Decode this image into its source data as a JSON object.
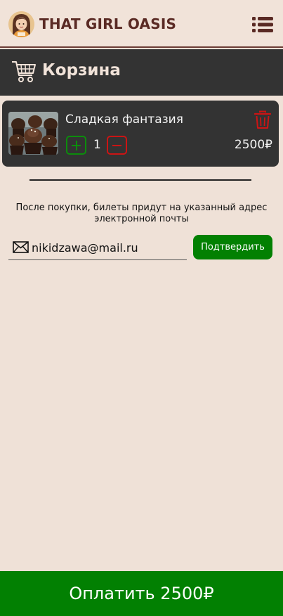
{
  "header": {
    "brand": "THAT GIRL OASIS",
    "logo_icon": "girl-avatar-logo",
    "menu_icon": "list-menu-icon"
  },
  "page": {
    "title": "Корзина",
    "title_icon": "shopping-cart-icon"
  },
  "cart": {
    "items": [
      {
        "name": "Сладкая фантазия",
        "quantity": "1",
        "price": "2500₽",
        "image_icon": "chocolate-cupcakes-photo"
      }
    ]
  },
  "checkout": {
    "notice": "После покупки, билеты придут на указанный адрес электронной почты",
    "email_value": "nikidzawa@mail.ru",
    "confirm_label": "Подтвердить",
    "pay_label": "Оплатить 2500₽"
  },
  "colors": {
    "background": "#efe1d7",
    "dark_panel": "#333333",
    "brand_text": "#5a2a24",
    "accent_green": "#028002",
    "danger_red": "#cc1414"
  }
}
